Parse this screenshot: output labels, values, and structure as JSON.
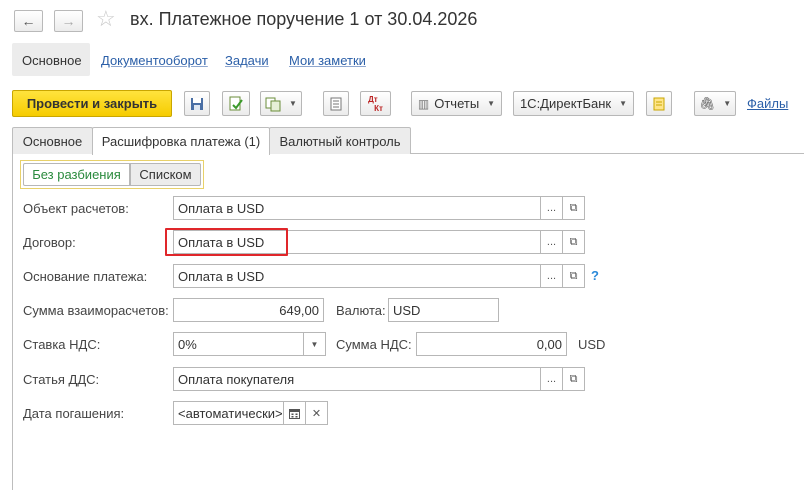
{
  "window": {
    "title": "вх. Платежное поручение 1 от 30.04.2026"
  },
  "sections": [
    {
      "label": "Основное",
      "active": true
    },
    {
      "label": "Документооборот",
      "active": false
    },
    {
      "label": "Задачи",
      "active": false
    },
    {
      "label": "Мои заметки",
      "active": false
    }
  ],
  "toolbar": {
    "post_close": "Провести и закрыть",
    "dt_kt_top": "Дт",
    "dt_kt_bottom": "Кт",
    "reports": "Отчеты",
    "directbank": "1С:ДиректБанк",
    "files": "Файлы"
  },
  "tabs": [
    {
      "label": "Основное",
      "active": false
    },
    {
      "label": "Расшифровка платежа (1)",
      "active": true
    },
    {
      "label": "Валютный контроль",
      "active": false
    }
  ],
  "split_mode": {
    "options": [
      "Без разбиения",
      "Списком"
    ],
    "selected": "Без разбиения"
  },
  "form": {
    "settlement_object": {
      "label": "Объект расчетов:",
      "value": "Оплата в USD"
    },
    "contract": {
      "label": "Договор:",
      "value": "Оплата в USD"
    },
    "payment_basis": {
      "label": "Основание платежа:",
      "value": "Оплата в USD",
      "help": "?"
    },
    "settlement_amount": {
      "label": "Сумма взаиморасчетов:",
      "value": "649,00"
    },
    "currency": {
      "label": "Валюта:",
      "value": "USD"
    },
    "vat_rate": {
      "label": "Ставка НДС:",
      "value": "0%"
    },
    "vat_amount": {
      "label": "Сумма НДС:",
      "value": "0,00",
      "unit": "USD"
    },
    "cash_flow_item": {
      "label": "Статья ДДС:",
      "value": "Оплата покупателя"
    },
    "due_date": {
      "label": "Дата погашения:",
      "value": "<автоматически>"
    }
  },
  "colors": {
    "primary_button": "#f6cc00",
    "link": "#2b5fa8",
    "highlight": "#e0262a",
    "selected_option": "#2a8a3d"
  }
}
